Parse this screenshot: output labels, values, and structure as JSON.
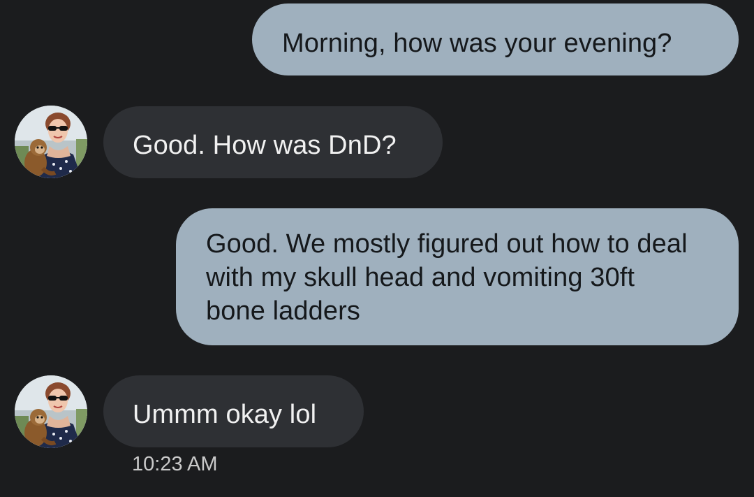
{
  "conversation": {
    "messages": [
      {
        "direction": "outgoing",
        "text": "Morning, how was your evening?"
      },
      {
        "direction": "incoming",
        "text": "Good. How was DnD?",
        "avatar": "contact-avatar-photo"
      },
      {
        "direction": "outgoing",
        "text": "Good. We mostly figured out how to deal with my skull head and vomiting 30ft bone ladders"
      },
      {
        "direction": "incoming",
        "text": "Ummm okay lol",
        "avatar": "contact-avatar-photo"
      }
    ],
    "last_timestamp": "10:23 AM"
  },
  "colors": {
    "background": "#1b1c1e",
    "outgoing_bubble": "#9fb0be",
    "incoming_bubble": "#2e3034"
  }
}
